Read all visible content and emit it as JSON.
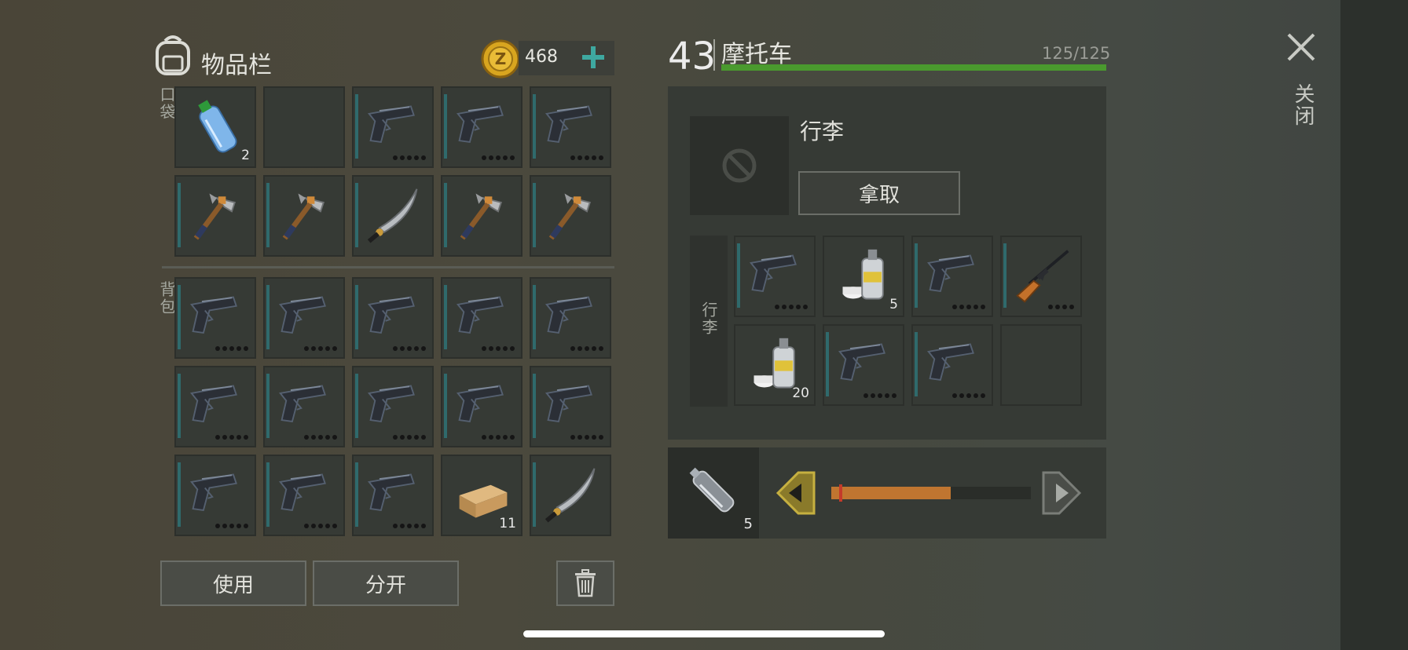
{
  "inventory": {
    "title": "物品栏",
    "coins": "468",
    "pocket_label": "口袋",
    "backpack_label": "背包",
    "pocket_slots": [
      {
        "icon": "water-bottle-icon",
        "count": "2"
      },
      {
        "icon": "empty",
        "count": ""
      },
      {
        "icon": "pistol-icon",
        "count": ""
      },
      {
        "icon": "pistol-icon",
        "count": ""
      },
      {
        "icon": "pistol-icon",
        "count": ""
      },
      {
        "icon": "hammer-icon",
        "count": ""
      },
      {
        "icon": "hammer-icon",
        "count": ""
      },
      {
        "icon": "machete-icon",
        "count": ""
      },
      {
        "icon": "hammer-icon",
        "count": ""
      },
      {
        "icon": "hammer-icon",
        "count": ""
      }
    ],
    "backpack_slots": [
      {
        "icon": "pistol-icon",
        "count": ""
      },
      {
        "icon": "pistol-icon",
        "count": ""
      },
      {
        "icon": "pistol-icon",
        "count": ""
      },
      {
        "icon": "pistol-icon",
        "count": ""
      },
      {
        "icon": "pistol-icon",
        "count": ""
      },
      {
        "icon": "pistol-icon",
        "count": ""
      },
      {
        "icon": "pistol-icon",
        "count": ""
      },
      {
        "icon": "pistol-icon",
        "count": ""
      },
      {
        "icon": "pistol-icon",
        "count": ""
      },
      {
        "icon": "pistol-icon",
        "count": ""
      },
      {
        "icon": "pistol-icon",
        "count": ""
      },
      {
        "icon": "pistol-icon",
        "count": ""
      },
      {
        "icon": "pistol-icon",
        "count": ""
      },
      {
        "icon": "wood-plank-icon",
        "count": "11"
      },
      {
        "icon": "machete-icon",
        "count": ""
      }
    ],
    "use_label": "使用",
    "split_label": "分开"
  },
  "vehicle": {
    "level": "43",
    "name": "摩托车",
    "durability": "125/125",
    "durability_fraction": 1.0,
    "luggage_title": "行李",
    "take_label": "拿取",
    "luggage_side_label": "行李",
    "luggage_slots": [
      {
        "icon": "pistol-icon",
        "count": ""
      },
      {
        "icon": "spray-paint-icon",
        "count": "5"
      },
      {
        "icon": "pistol-icon",
        "count": ""
      },
      {
        "icon": "rifle-icon",
        "count": ""
      },
      {
        "icon": "spray-paint-icon",
        "count": "20"
      },
      {
        "icon": "pistol-icon",
        "count": ""
      },
      {
        "icon": "pistol-icon",
        "count": ""
      },
      {
        "icon": "empty",
        "count": ""
      }
    ],
    "fuel": {
      "item_icon": "fuel-bottle-icon",
      "count": "5",
      "fill_fraction": 0.6
    }
  },
  "close_label": "关闭",
  "colors": {
    "accent": "#3ea8a0",
    "durability": "#4a9a2e",
    "fuel": "#c07530",
    "slot_bar": "#2f6a6c"
  }
}
